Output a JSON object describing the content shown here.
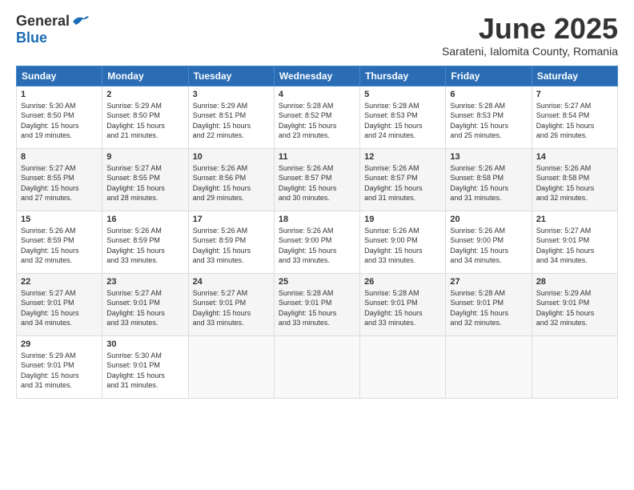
{
  "header": {
    "logo_general": "General",
    "logo_blue": "Blue",
    "month": "June 2025",
    "location": "Sarateni, Ialomita County, Romania"
  },
  "weekdays": [
    "Sunday",
    "Monday",
    "Tuesday",
    "Wednesday",
    "Thursday",
    "Friday",
    "Saturday"
  ],
  "weeks": [
    [
      {
        "day": "1",
        "info": "Sunrise: 5:30 AM\nSunset: 8:50 PM\nDaylight: 15 hours\nand 19 minutes."
      },
      {
        "day": "2",
        "info": "Sunrise: 5:29 AM\nSunset: 8:50 PM\nDaylight: 15 hours\nand 21 minutes."
      },
      {
        "day": "3",
        "info": "Sunrise: 5:29 AM\nSunset: 8:51 PM\nDaylight: 15 hours\nand 22 minutes."
      },
      {
        "day": "4",
        "info": "Sunrise: 5:28 AM\nSunset: 8:52 PM\nDaylight: 15 hours\nand 23 minutes."
      },
      {
        "day": "5",
        "info": "Sunrise: 5:28 AM\nSunset: 8:53 PM\nDaylight: 15 hours\nand 24 minutes."
      },
      {
        "day": "6",
        "info": "Sunrise: 5:28 AM\nSunset: 8:53 PM\nDaylight: 15 hours\nand 25 minutes."
      },
      {
        "day": "7",
        "info": "Sunrise: 5:27 AM\nSunset: 8:54 PM\nDaylight: 15 hours\nand 26 minutes."
      }
    ],
    [
      {
        "day": "8",
        "info": "Sunrise: 5:27 AM\nSunset: 8:55 PM\nDaylight: 15 hours\nand 27 minutes."
      },
      {
        "day": "9",
        "info": "Sunrise: 5:27 AM\nSunset: 8:55 PM\nDaylight: 15 hours\nand 28 minutes."
      },
      {
        "day": "10",
        "info": "Sunrise: 5:26 AM\nSunset: 8:56 PM\nDaylight: 15 hours\nand 29 minutes."
      },
      {
        "day": "11",
        "info": "Sunrise: 5:26 AM\nSunset: 8:57 PM\nDaylight: 15 hours\nand 30 minutes."
      },
      {
        "day": "12",
        "info": "Sunrise: 5:26 AM\nSunset: 8:57 PM\nDaylight: 15 hours\nand 31 minutes."
      },
      {
        "day": "13",
        "info": "Sunrise: 5:26 AM\nSunset: 8:58 PM\nDaylight: 15 hours\nand 31 minutes."
      },
      {
        "day": "14",
        "info": "Sunrise: 5:26 AM\nSunset: 8:58 PM\nDaylight: 15 hours\nand 32 minutes."
      }
    ],
    [
      {
        "day": "15",
        "info": "Sunrise: 5:26 AM\nSunset: 8:59 PM\nDaylight: 15 hours\nand 32 minutes."
      },
      {
        "day": "16",
        "info": "Sunrise: 5:26 AM\nSunset: 8:59 PM\nDaylight: 15 hours\nand 33 minutes."
      },
      {
        "day": "17",
        "info": "Sunrise: 5:26 AM\nSunset: 8:59 PM\nDaylight: 15 hours\nand 33 minutes."
      },
      {
        "day": "18",
        "info": "Sunrise: 5:26 AM\nSunset: 9:00 PM\nDaylight: 15 hours\nand 33 minutes."
      },
      {
        "day": "19",
        "info": "Sunrise: 5:26 AM\nSunset: 9:00 PM\nDaylight: 15 hours\nand 33 minutes."
      },
      {
        "day": "20",
        "info": "Sunrise: 5:26 AM\nSunset: 9:00 PM\nDaylight: 15 hours\nand 34 minutes."
      },
      {
        "day": "21",
        "info": "Sunrise: 5:27 AM\nSunset: 9:01 PM\nDaylight: 15 hours\nand 34 minutes."
      }
    ],
    [
      {
        "day": "22",
        "info": "Sunrise: 5:27 AM\nSunset: 9:01 PM\nDaylight: 15 hours\nand 34 minutes."
      },
      {
        "day": "23",
        "info": "Sunrise: 5:27 AM\nSunset: 9:01 PM\nDaylight: 15 hours\nand 33 minutes."
      },
      {
        "day": "24",
        "info": "Sunrise: 5:27 AM\nSunset: 9:01 PM\nDaylight: 15 hours\nand 33 minutes."
      },
      {
        "day": "25",
        "info": "Sunrise: 5:28 AM\nSunset: 9:01 PM\nDaylight: 15 hours\nand 33 minutes."
      },
      {
        "day": "26",
        "info": "Sunrise: 5:28 AM\nSunset: 9:01 PM\nDaylight: 15 hours\nand 33 minutes."
      },
      {
        "day": "27",
        "info": "Sunrise: 5:28 AM\nSunset: 9:01 PM\nDaylight: 15 hours\nand 32 minutes."
      },
      {
        "day": "28",
        "info": "Sunrise: 5:29 AM\nSunset: 9:01 PM\nDaylight: 15 hours\nand 32 minutes."
      }
    ],
    [
      {
        "day": "29",
        "info": "Sunrise: 5:29 AM\nSunset: 9:01 PM\nDaylight: 15 hours\nand 31 minutes."
      },
      {
        "day": "30",
        "info": "Sunrise: 5:30 AM\nSunset: 9:01 PM\nDaylight: 15 hours\nand 31 minutes."
      },
      {
        "day": "",
        "info": ""
      },
      {
        "day": "",
        "info": ""
      },
      {
        "day": "",
        "info": ""
      },
      {
        "day": "",
        "info": ""
      },
      {
        "day": "",
        "info": ""
      }
    ]
  ]
}
